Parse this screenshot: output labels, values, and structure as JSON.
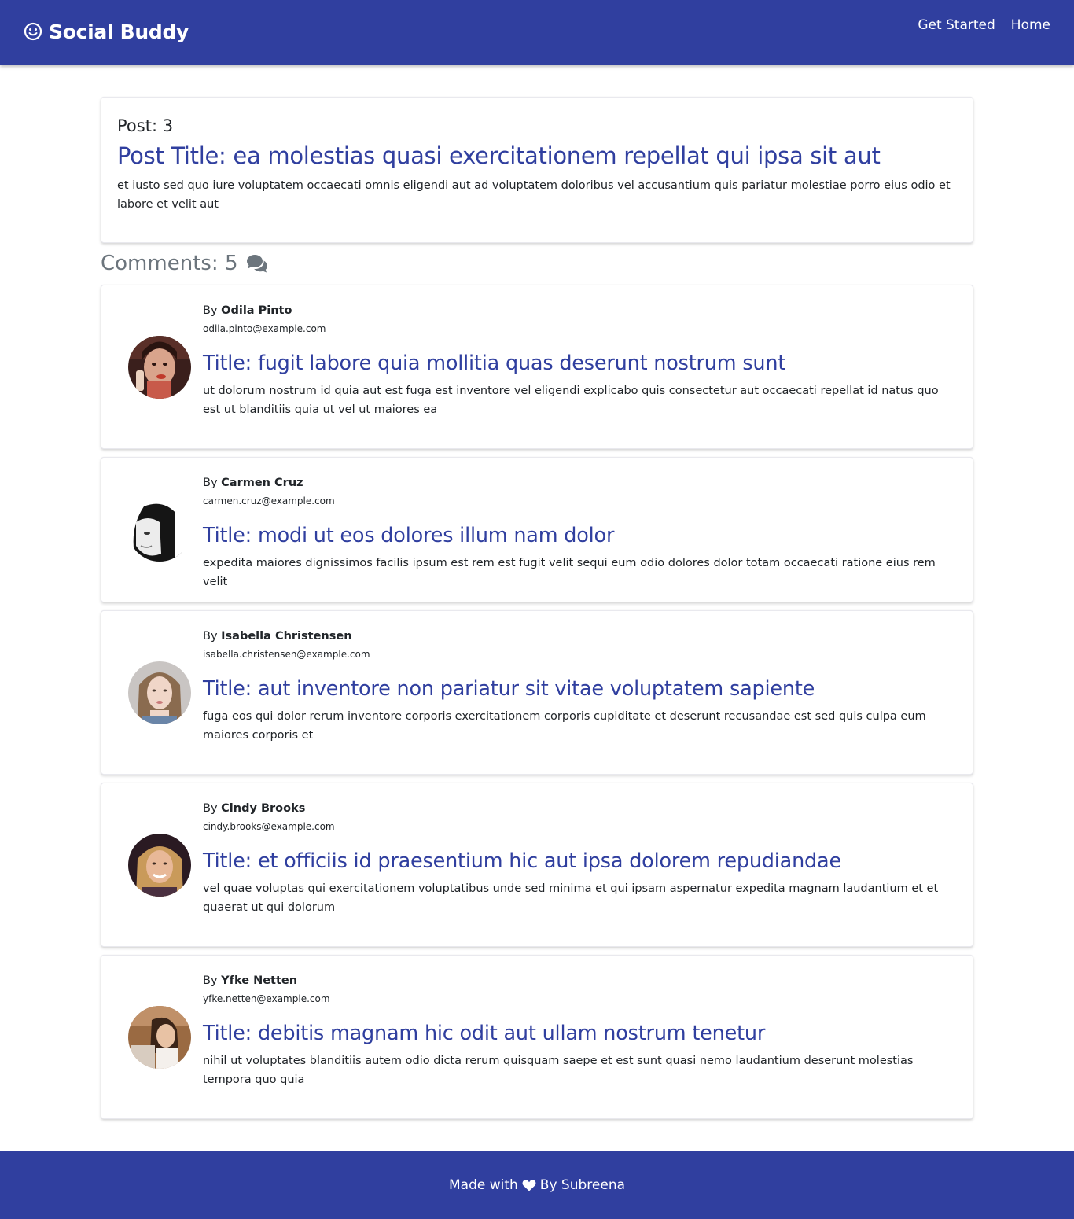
{
  "navbar": {
    "brand": "Social Buddy",
    "links": [
      "Get Started",
      "Home"
    ]
  },
  "post": {
    "label": "Post: 3",
    "title": "Post Title: ea molestias quasi exercitationem repellat qui ipsa sit aut",
    "body": "et iusto sed quo iure voluptatem occaecati omnis eligendi aut ad voluptatem doloribus vel accusantium quis pariatur molestiae porro eius odio et labore et velit aut"
  },
  "comments_heading": "Comments: 5",
  "comments": [
    {
      "by": "By",
      "author": "Odila Pinto",
      "email": "odila.pinto@example.com",
      "title": "Title: fugit labore quia mollitia quas deserunt nostrum sunt",
      "body": "ut dolorum nostrum id quia aut est fuga est inventore vel eligendi explicabo quis consectetur aut occaecati repellat id natus quo est ut blanditiis quia ut vel ut maiores ea"
    },
    {
      "by": "By",
      "author": "Carmen Cruz",
      "email": "carmen.cruz@example.com",
      "title": "Title: modi ut eos dolores illum nam dolor",
      "body": "expedita maiores dignissimos facilis ipsum est rem est fugit velit sequi eum odio dolores dolor totam occaecati ratione eius rem velit"
    },
    {
      "by": "By",
      "author": "Isabella Christensen",
      "email": "isabella.christensen@example.com",
      "title": "Title: aut inventore non pariatur sit vitae voluptatem sapiente",
      "body": "fuga eos qui dolor rerum inventore corporis exercitationem corporis cupiditate et deserunt recusandae est sed quis culpa eum maiores corporis et"
    },
    {
      "by": "By",
      "author": "Cindy Brooks",
      "email": "cindy.brooks@example.com",
      "title": "Title: et officiis id praesentium hic aut ipsa dolorem repudiandae",
      "body": "vel quae voluptas qui exercitationem voluptatibus unde sed minima et qui ipsam aspernatur expedita magnam laudantium et et quaerat ut qui dolorum"
    },
    {
      "by": "By",
      "author": "Yfke Netten",
      "email": "yfke.netten@example.com",
      "title": "Title: debitis magnam hic odit aut ullam nostrum tenetur",
      "body": "nihil ut voluptates blanditiis autem odio dicta rerum quisquam saepe et est sunt quasi nemo laudantium deserunt molestias tempora quo quia"
    }
  ],
  "footer": {
    "before": "Made with",
    "after": "By Subreena"
  },
  "colors": {
    "primary": "#303f9f",
    "muted": "#6c757d"
  }
}
